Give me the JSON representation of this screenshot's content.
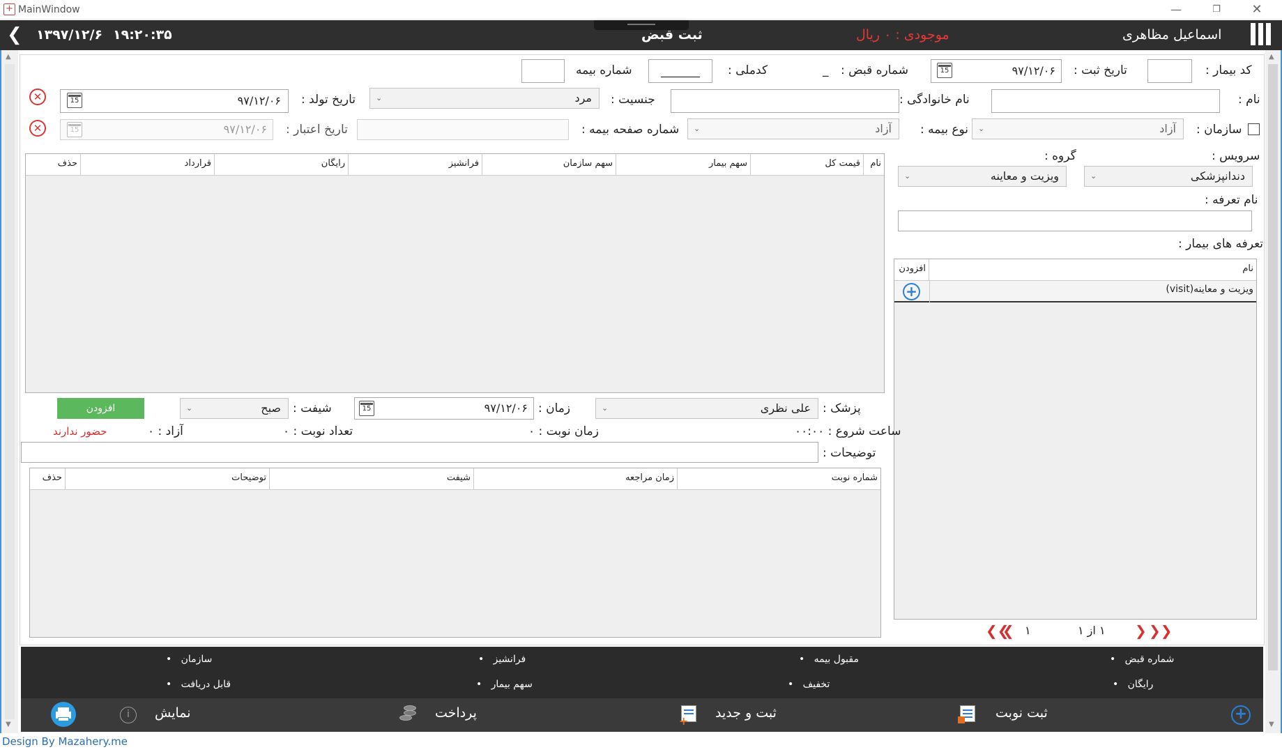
{
  "window": {
    "title": "MainWindow"
  },
  "header": {
    "user_name": "اسماعیل مظاهری",
    "balance": "موجودی : ۰ ریال",
    "page_title": "ثبت قبض",
    "time": "۱۹:۲۰:۳۵",
    "date": "۱۳۹۷/۱۲/۶"
  },
  "row1": {
    "patient_code_label": "کد بیمار :",
    "patient_code_value": "",
    "reg_date_label": "تاریخ ثبت :",
    "reg_date_value": "۹۷/۱۲/۰۶",
    "receipt_no_label": "شماره قبض :",
    "receipt_no_value": "_",
    "national_code_label": "کدملی :",
    "national_code_value": "_______",
    "insurance_no_label": "شماره بیمه",
    "insurance_no_value": ""
  },
  "row2": {
    "name_label": "نام :",
    "name_value": "",
    "family_label": "نام خانوادگی :",
    "family_value": "",
    "gender_label": "جنسیت :",
    "gender_value": "مرد",
    "birth_label": "تاریخ تولد :",
    "birth_value": "۹۷/۱۲/۰۶"
  },
  "row3": {
    "org_label": "سازمان :",
    "org_value": "آزاد",
    "ins_type_label": "نوع بیمه :",
    "ins_type_value": "آزاد",
    "ins_page_label": "شماره صفحه بیمه :",
    "ins_page_value": "",
    "validity_label": "تاریخ اعتبار :",
    "validity_value": "۹۷/۱۲/۰۶"
  },
  "service": {
    "service_label": "سرویس :",
    "service_value": "دندانپزشکی",
    "group_label": "گروه :",
    "group_value": "ویزیت و معاینه",
    "tariff_name_label": "نام تعرفه :",
    "tariff_name_value": "",
    "patient_tariffs_label": "تعرفه های بیمار :",
    "tariff_table": {
      "headers": [
        "نام",
        "افزودن"
      ],
      "rows": [
        {
          "name": "ویزیت و معاینه(visit)"
        }
      ]
    },
    "pager": {
      "page_text": "۱ از ۱",
      "current": "۱"
    }
  },
  "services_table": {
    "headers": [
      "نام",
      "قیمت کل",
      "سهم بیمار",
      "سهم سازمان",
      "فرانشیز",
      "رایگان",
      "قرارداد",
      "حذف"
    ]
  },
  "appointment": {
    "doctor_label": "پزشک :",
    "doctor_value": "علی نظری",
    "time_label": "زمان :",
    "time_value": "۹۷/۱۲/۰۶",
    "shift_label": "شیفت :",
    "shift_value": "صبح",
    "add_button": "افزودن",
    "start_time_label": "ساعت شروع : ۰۰:۰۰",
    "slot_time_label": "زمان نوبت : ۰",
    "slot_count_label": "تعداد نوبت : ۰",
    "free_label": "آزاد : ۰",
    "absent_label": "حضور ندارند",
    "desc_label": "توضیحات :",
    "desc_value": ""
  },
  "appointments_table": {
    "headers": [
      "شماره نوبت",
      "زمان مراجعه",
      "شیفت",
      "توضیحات",
      "حذف"
    ]
  },
  "summary": {
    "receipt_no": "شماره قبض",
    "insurance_accepted": "مقبول بیمه",
    "franchise": "فرانشیز",
    "organization": "سازمان",
    "free": "رایگان",
    "discount": "تخفیف",
    "patient_share": "سهم بیمار",
    "receivable": "قابل دریافت"
  },
  "toolbar": {
    "register_appt": "ثبت نوبت",
    "save_new": "ثبت و جدید",
    "pay": "پرداخت",
    "show": "نمایش"
  },
  "footer": {
    "credit": "Design By Mazahery.me"
  },
  "colors": {
    "header_bg": "#2f2f2f",
    "balance": "#e53935",
    "add_green": "#5cb85c",
    "absent_red": "#d32f2f",
    "frame_blue": "#4a90d6"
  }
}
